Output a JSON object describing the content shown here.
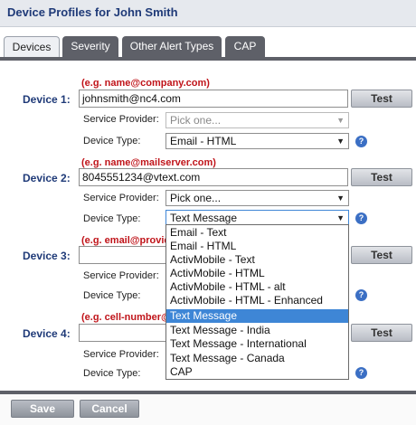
{
  "header": {
    "title": "Device Profiles for John Smith"
  },
  "tabs": [
    {
      "label": "Devices",
      "active": true
    },
    {
      "label": "Severity",
      "active": false
    },
    {
      "label": "Other Alert Types",
      "active": false
    },
    {
      "label": "CAP",
      "active": false
    }
  ],
  "devices": [
    {
      "label": "Device 1:",
      "hint": "(e.g. name@company.com)",
      "value": "johnsmith@nc4.com",
      "test_label": "Test",
      "provider_label": "Service Provider:",
      "provider_value": "Pick one...",
      "type_label": "Device Type:",
      "type_value": "Email - HTML"
    },
    {
      "label": "Device 2:",
      "hint": "(e.g. name@mailserver.com)",
      "value": "8045551234@vtext.com",
      "test_label": "Test",
      "provider_label": "Service Provider:",
      "provider_value": "Pick one...",
      "type_label": "Device Type:",
      "type_value": "Text Message"
    },
    {
      "label": "Device 3:",
      "hint": "(e.g. email@provid",
      "value": "",
      "test_label": "Test",
      "provider_label": "Service Provider:",
      "type_label": "Device Type:"
    },
    {
      "label": "Device 4:",
      "hint": "(e.g. cell-number@",
      "value": "",
      "test_label": "Test",
      "provider_label": "Service Provider:",
      "type_label": "Device Type:"
    }
  ],
  "dropdown_options": [
    "Email - Text",
    "Email - HTML",
    "ActivMobile - Text",
    "ActivMobile - HTML",
    "ActivMobile - HTML - alt",
    "ActivMobile - HTML - Enhanced",
    "Text Message",
    "Text Message - India",
    "Text Message - International",
    "Text Message - Canada",
    "CAP"
  ],
  "dropdown_selected_index": 6,
  "footer": {
    "save_label": "Save",
    "cancel_label": "Cancel"
  },
  "colors": {
    "accent": "#3e86d6",
    "title": "#1f3a78",
    "hint": "#c0141a",
    "tab_bar": "#5e6068"
  },
  "icons": {
    "help": "help-icon",
    "arrow": "chevron-down-icon"
  }
}
